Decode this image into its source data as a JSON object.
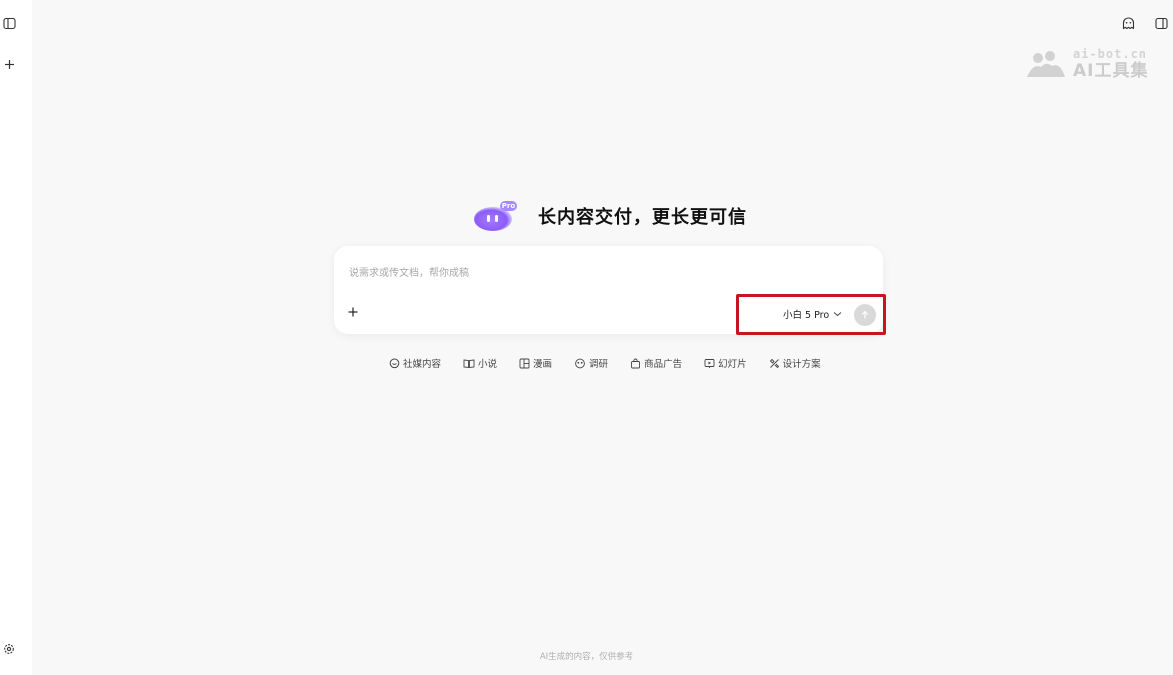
{
  "sidebar": {
    "toggle_icon": "sidebar-toggle-icon",
    "new_icon": "plus-icon",
    "settings_icon": "gear-icon"
  },
  "topbar": {
    "left_button_icon": "ghost-chat-icon",
    "right_button_icon": "panel-toggle-icon"
  },
  "watermark": {
    "line1": "ai-bot.cn",
    "line2": "AI工具集"
  },
  "hero": {
    "badge": "Pro",
    "title": "长内容交付，更长更可信"
  },
  "composer": {
    "placeholder": "说需求或传文档，帮你成稿",
    "value": "",
    "model_label": "小白 5 Pro",
    "send_icon": "arrow-up-icon"
  },
  "chips": [
    {
      "label": "社媒内容",
      "icon": "chat-bubble-icon"
    },
    {
      "label": "小说",
      "icon": "book-icon"
    },
    {
      "label": "漫画",
      "icon": "comic-icon"
    },
    {
      "label": "调研",
      "icon": "research-icon"
    },
    {
      "label": "商品广告",
      "icon": "shopping-bag-icon"
    },
    {
      "label": "幻灯片",
      "icon": "slides-icon"
    },
    {
      "label": "设计方案",
      "icon": "design-icon"
    }
  ],
  "footer": {
    "note": "AI生成的内容，仅供参考"
  },
  "colors": {
    "background": "#f8f8f9",
    "highlight": "#c8141e",
    "mascot": "#8b5cf6"
  }
}
